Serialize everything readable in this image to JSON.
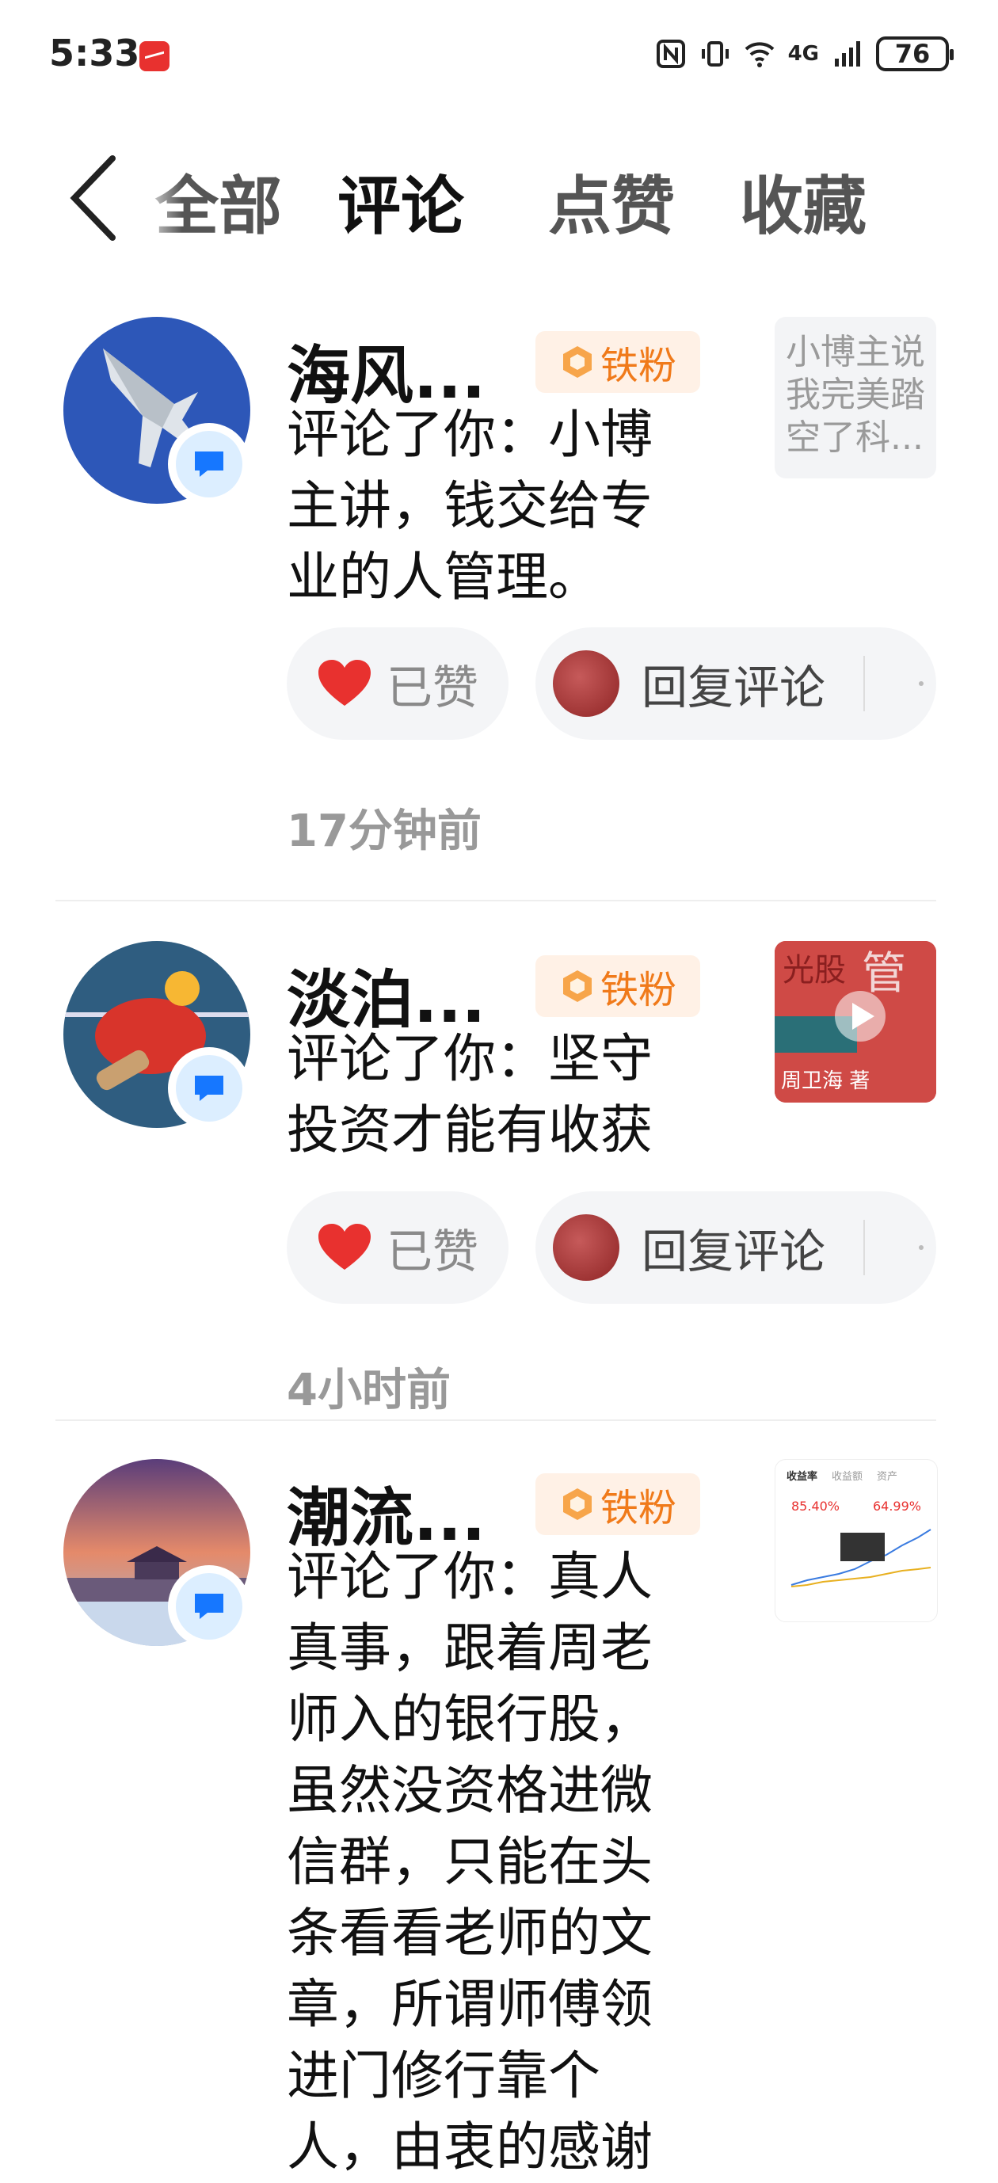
{
  "status_bar": {
    "time": "5:33",
    "network": "4G",
    "battery": "76"
  },
  "tabs": {
    "items": [
      {
        "label": "全部"
      },
      {
        "label": "评论"
      },
      {
        "label": "点赞"
      },
      {
        "label": "收藏"
      }
    ],
    "active": "评论"
  },
  "notifications": [
    {
      "name": "海风...",
      "badge": "铁粉",
      "comment": "评论了你：小博主讲，钱交给专业的人管理。",
      "comment_lines": [
        "评论了你：小博",
        "主讲，钱交给专",
        "业的人管理。"
      ],
      "thumbnail_text": "小博主说我完美踏空了科...",
      "liked_label": "已赞",
      "reply_label": "回复评论",
      "time_ago": "17分钟前"
    },
    {
      "name": "淡泊...",
      "badge": "铁粉",
      "comment": "评论了你：坚守投资才能有收获",
      "comment_lines": [
        "评论了你：坚守",
        "投资才能有收获"
      ],
      "thumbnail_caption": "周卫海 著",
      "liked_label": "已赞",
      "reply_label": "回复评论",
      "time_ago": "4小时前"
    },
    {
      "name": "潮流...",
      "badge": "铁粉",
      "comment": "评论了你：真人真事，跟着周老师入的银行股，虽然没资格进微信群，只能在头条看看老师的文章，所谓师傅领进门修行靠个人，由衷的感谢",
      "comment_lines": [
        "评论了你：真人",
        "真事，跟着周老",
        "师入的银行股，",
        "虽然没资格进微",
        "信群，只能在头",
        "条看看老师的文",
        "章，所谓师傅领",
        "进门修行靠个",
        "人，由衷的感谢"
      ],
      "thumbnail": {
        "tabs": [
          "收益率",
          "收益额",
          "资产"
        ],
        "values": [
          "85.40%",
          "64.99%"
        ]
      }
    }
  ],
  "colors": {
    "fan_badge_bg": "#fff1e6",
    "fan_badge_text": "#f07a1a",
    "like_heart": "#e8312f",
    "message_badge": "#1677ff"
  }
}
